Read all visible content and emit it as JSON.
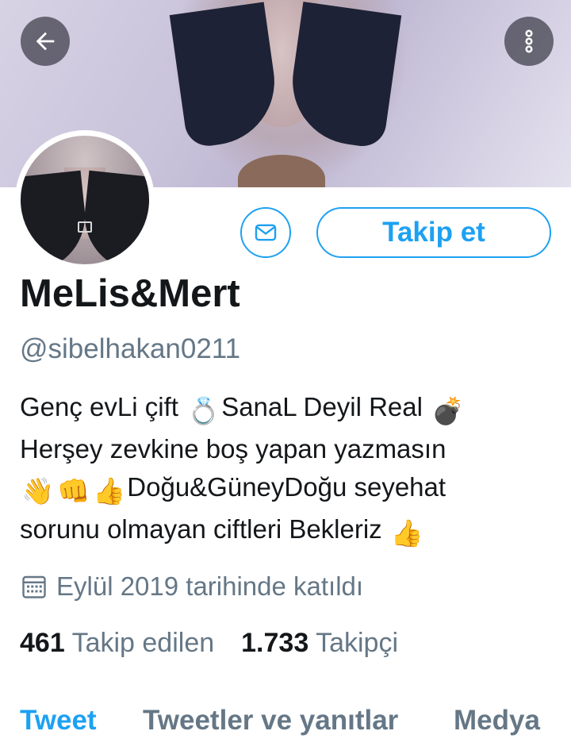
{
  "header": {
    "back_icon": "arrow-left-icon",
    "more_icon": "more-vertical-icon"
  },
  "profile": {
    "name": "MeLis&Mert",
    "handle": "@sibelhakan0211",
    "follow_label": "Takip et",
    "message_icon": "envelope-icon",
    "bio": {
      "line1_a": "Genç evLi çift ",
      "line1_emoji1": "💍",
      "line1_b": "SanaL Deyil Real ",
      "line1_emoji2": "💣",
      "line2": "Herşey zevkine boş yapan yazmasın",
      "line3_emoji1": "👋",
      "line3_emoji2": "👊",
      "line3_emoji3": "👍",
      "line3_text": "Doğu&GüneyDoğu seyehat",
      "line4_text": "sorunu olmayan ciftleri Bekleriz ",
      "line4_emoji": "👍"
    },
    "joined_icon": "calendar-icon",
    "joined": "Eylül 2019 tarihinde katıldı",
    "following_count": "461",
    "following_label": "Takip edilen",
    "followers_count": "1.733",
    "followers_label": "Takipçi"
  },
  "tabs": [
    {
      "label": "Tweet",
      "active": true
    },
    {
      "label": "Tweetler ve yanıtlar",
      "active": false
    },
    {
      "label": "Medya",
      "active": false
    }
  ],
  "colors": {
    "accent": "#1da1f2",
    "secondary_text": "#657786",
    "primary_text": "#14171a"
  }
}
